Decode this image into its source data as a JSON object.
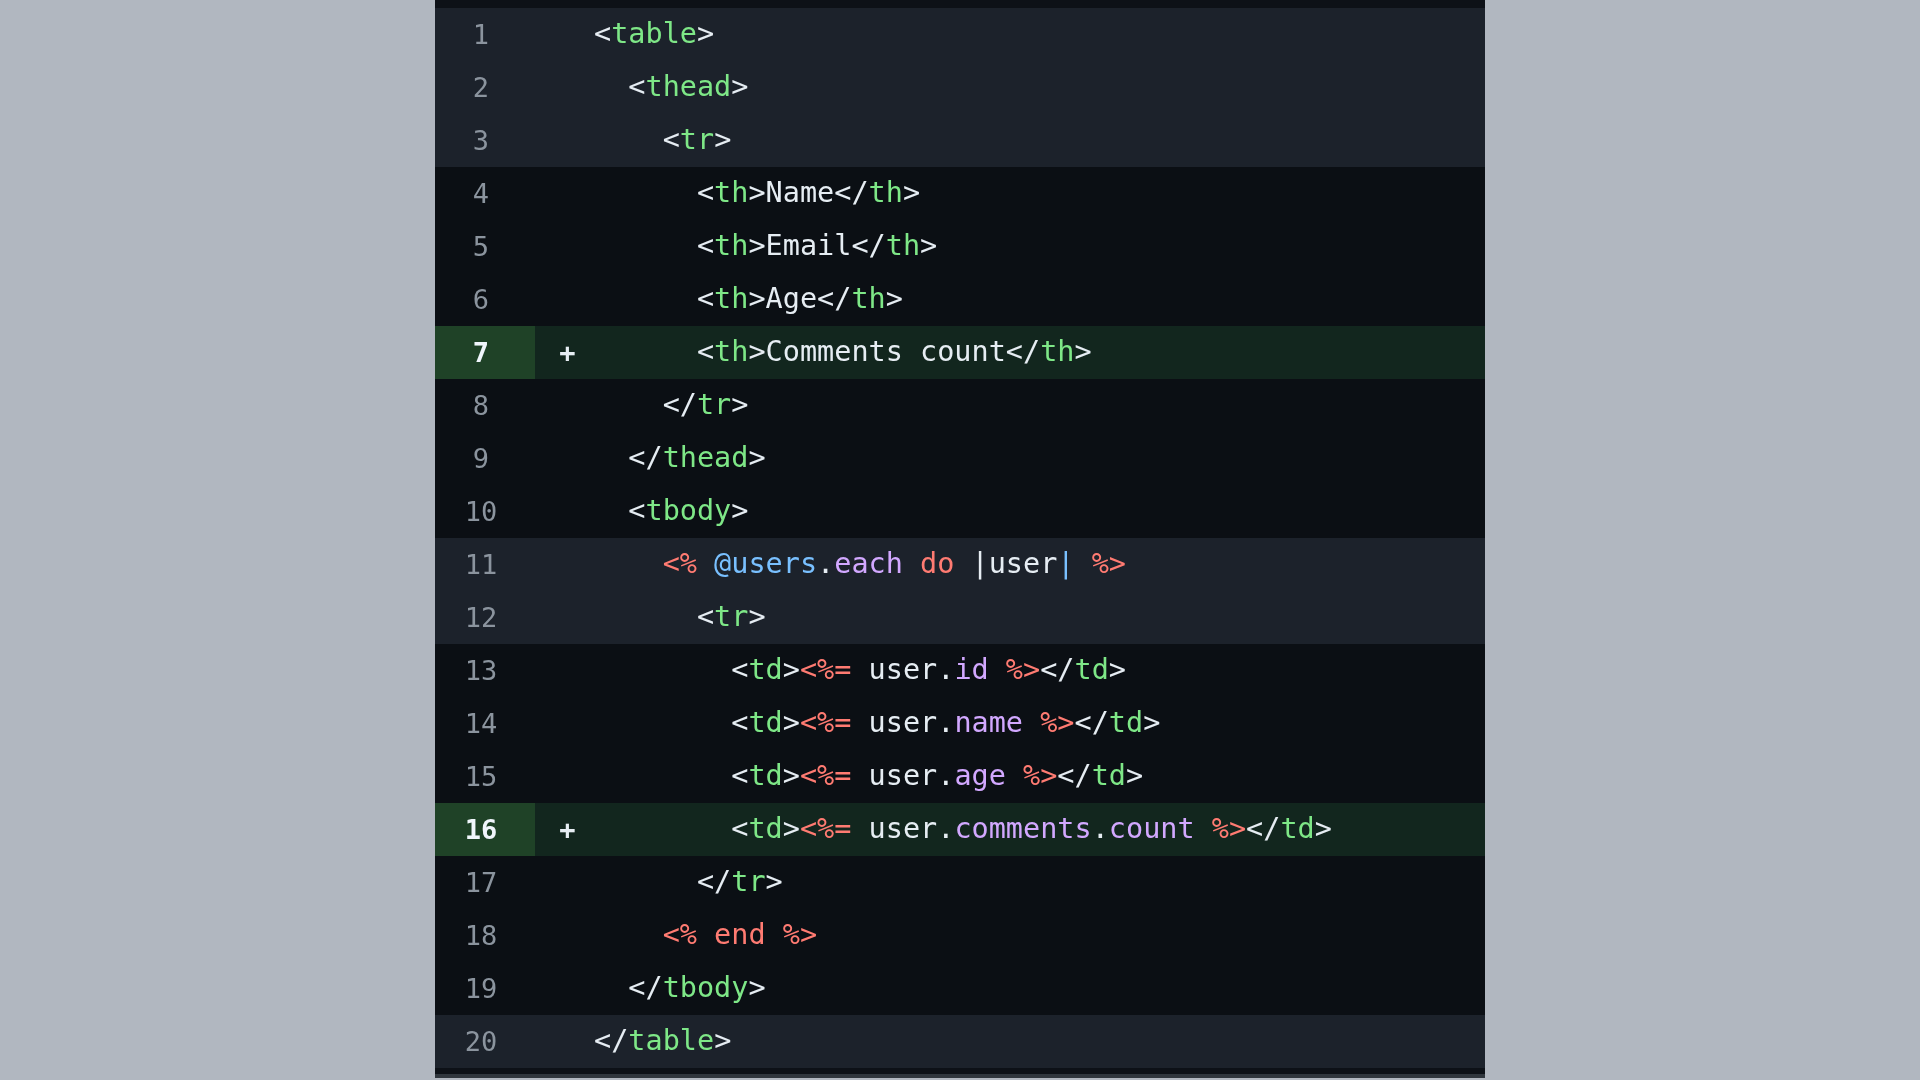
{
  "diff": {
    "lines": [
      {
        "number": "1",
        "added": false,
        "shaded": true,
        "tokens": [
          {
            "kind": "punct",
            "text": "<"
          },
          {
            "kind": "tag",
            "text": "table"
          },
          {
            "kind": "punct",
            "text": ">"
          }
        ]
      },
      {
        "number": "2",
        "added": false,
        "shaded": true,
        "tokens": [
          {
            "kind": "punct",
            "text": "  <"
          },
          {
            "kind": "tag",
            "text": "thead"
          },
          {
            "kind": "punct",
            "text": ">"
          }
        ]
      },
      {
        "number": "3",
        "added": false,
        "shaded": true,
        "tokens": [
          {
            "kind": "punct",
            "text": "    <"
          },
          {
            "kind": "tag",
            "text": "tr"
          },
          {
            "kind": "punct",
            "text": ">"
          }
        ]
      },
      {
        "number": "4",
        "added": false,
        "shaded": false,
        "tokens": [
          {
            "kind": "punct",
            "text": "      <"
          },
          {
            "kind": "tag",
            "text": "th"
          },
          {
            "kind": "punct",
            "text": ">Name</"
          },
          {
            "kind": "tag",
            "text": "th"
          },
          {
            "kind": "punct",
            "text": ">"
          }
        ]
      },
      {
        "number": "5",
        "added": false,
        "shaded": false,
        "tokens": [
          {
            "kind": "punct",
            "text": "      <"
          },
          {
            "kind": "tag",
            "text": "th"
          },
          {
            "kind": "punct",
            "text": ">Email</"
          },
          {
            "kind": "tag",
            "text": "th"
          },
          {
            "kind": "punct",
            "text": ">"
          }
        ]
      },
      {
        "number": "6",
        "added": false,
        "shaded": false,
        "tokens": [
          {
            "kind": "punct",
            "text": "      <"
          },
          {
            "kind": "tag",
            "text": "th"
          },
          {
            "kind": "punct",
            "text": ">Age</"
          },
          {
            "kind": "tag",
            "text": "th"
          },
          {
            "kind": "punct",
            "text": ">"
          }
        ]
      },
      {
        "number": "7",
        "added": true,
        "marker": "+",
        "shaded": false,
        "tokens": [
          {
            "kind": "punct",
            "text": "      <"
          },
          {
            "kind": "tag",
            "text": "th"
          },
          {
            "kind": "punct",
            "text": ">Comments count</"
          },
          {
            "kind": "tag",
            "text": "th"
          },
          {
            "kind": "punct",
            "text": ">"
          }
        ]
      },
      {
        "number": "8",
        "added": false,
        "shaded": false,
        "tokens": [
          {
            "kind": "punct",
            "text": "    </"
          },
          {
            "kind": "tag",
            "text": "tr"
          },
          {
            "kind": "punct",
            "text": ">"
          }
        ]
      },
      {
        "number": "9",
        "added": false,
        "shaded": false,
        "tokens": [
          {
            "kind": "punct",
            "text": "  </"
          },
          {
            "kind": "tag",
            "text": "thead"
          },
          {
            "kind": "punct",
            "text": ">"
          }
        ]
      },
      {
        "number": "10",
        "added": false,
        "shaded": false,
        "tokens": [
          {
            "kind": "punct",
            "text": "  <"
          },
          {
            "kind": "tag",
            "text": "tbody"
          },
          {
            "kind": "punct",
            "text": ">"
          }
        ]
      },
      {
        "number": "11",
        "added": false,
        "shaded": true,
        "tokens": [
          {
            "kind": "erb",
            "text": "    <% "
          },
          {
            "kind": "ivar",
            "text": "@users"
          },
          {
            "kind": "punct",
            "text": "."
          },
          {
            "kind": "method",
            "text": "each"
          },
          {
            "kind": "erb",
            "text": " do "
          },
          {
            "kind": "punct",
            "text": "|user"
          },
          {
            "kind": "ivar",
            "text": "|"
          },
          {
            "kind": "erb",
            "text": " %>"
          }
        ]
      },
      {
        "number": "12",
        "added": false,
        "shaded": true,
        "tokens": [
          {
            "kind": "punct",
            "text": "      <"
          },
          {
            "kind": "tag",
            "text": "tr"
          },
          {
            "kind": "punct",
            "text": ">"
          }
        ]
      },
      {
        "number": "13",
        "added": false,
        "shaded": false,
        "tokens": [
          {
            "kind": "punct",
            "text": "        <"
          },
          {
            "kind": "tag",
            "text": "td"
          },
          {
            "kind": "punct",
            "text": ">"
          },
          {
            "kind": "erb",
            "text": "<%="
          },
          {
            "kind": "punct",
            "text": " user."
          },
          {
            "kind": "method",
            "text": "id"
          },
          {
            "kind": "erb",
            "text": " %>"
          },
          {
            "kind": "punct",
            "text": "</"
          },
          {
            "kind": "tag",
            "text": "td"
          },
          {
            "kind": "punct",
            "text": ">"
          }
        ]
      },
      {
        "number": "14",
        "added": false,
        "shaded": false,
        "tokens": [
          {
            "kind": "punct",
            "text": "        <"
          },
          {
            "kind": "tag",
            "text": "td"
          },
          {
            "kind": "punct",
            "text": ">"
          },
          {
            "kind": "erb",
            "text": "<%="
          },
          {
            "kind": "punct",
            "text": " user."
          },
          {
            "kind": "method",
            "text": "name"
          },
          {
            "kind": "erb",
            "text": " %>"
          },
          {
            "kind": "punct",
            "text": "</"
          },
          {
            "kind": "tag",
            "text": "td"
          },
          {
            "kind": "punct",
            "text": ">"
          }
        ]
      },
      {
        "number": "15",
        "added": false,
        "shaded": false,
        "tokens": [
          {
            "kind": "punct",
            "text": "        <"
          },
          {
            "kind": "tag",
            "text": "td"
          },
          {
            "kind": "punct",
            "text": ">"
          },
          {
            "kind": "erb",
            "text": "<%="
          },
          {
            "kind": "punct",
            "text": " user."
          },
          {
            "kind": "method",
            "text": "age"
          },
          {
            "kind": "erb",
            "text": " %>"
          },
          {
            "kind": "punct",
            "text": "</"
          },
          {
            "kind": "tag",
            "text": "td"
          },
          {
            "kind": "punct",
            "text": ">"
          }
        ]
      },
      {
        "number": "16",
        "added": true,
        "marker": "+",
        "shaded": false,
        "tokens": [
          {
            "kind": "punct",
            "text": "        <"
          },
          {
            "kind": "tag",
            "text": "td"
          },
          {
            "kind": "punct",
            "text": ">"
          },
          {
            "kind": "erb",
            "text": "<%="
          },
          {
            "kind": "punct",
            "text": " user."
          },
          {
            "kind": "method",
            "text": "comments"
          },
          {
            "kind": "punct",
            "text": "."
          },
          {
            "kind": "method",
            "text": "count"
          },
          {
            "kind": "erb",
            "text": " %>"
          },
          {
            "kind": "punct",
            "text": "</"
          },
          {
            "kind": "tag",
            "text": "td"
          },
          {
            "kind": "punct",
            "text": ">"
          }
        ]
      },
      {
        "number": "17",
        "added": false,
        "shaded": false,
        "tokens": [
          {
            "kind": "punct",
            "text": "      </"
          },
          {
            "kind": "tag",
            "text": "tr"
          },
          {
            "kind": "punct",
            "text": ">"
          }
        ]
      },
      {
        "number": "18",
        "added": false,
        "shaded": false,
        "tokens": [
          {
            "kind": "erb",
            "text": "    <% end %>"
          }
        ]
      },
      {
        "number": "19",
        "added": false,
        "shaded": false,
        "tokens": [
          {
            "kind": "punct",
            "text": "  </"
          },
          {
            "kind": "tag",
            "text": "tbody"
          },
          {
            "kind": "punct",
            "text": ">"
          }
        ]
      },
      {
        "number": "20",
        "added": false,
        "shaded": true,
        "tokens": [
          {
            "kind": "punct",
            "text": "</"
          },
          {
            "kind": "tag",
            "text": "table"
          },
          {
            "kind": "punct",
            "text": ">"
          }
        ]
      }
    ]
  }
}
